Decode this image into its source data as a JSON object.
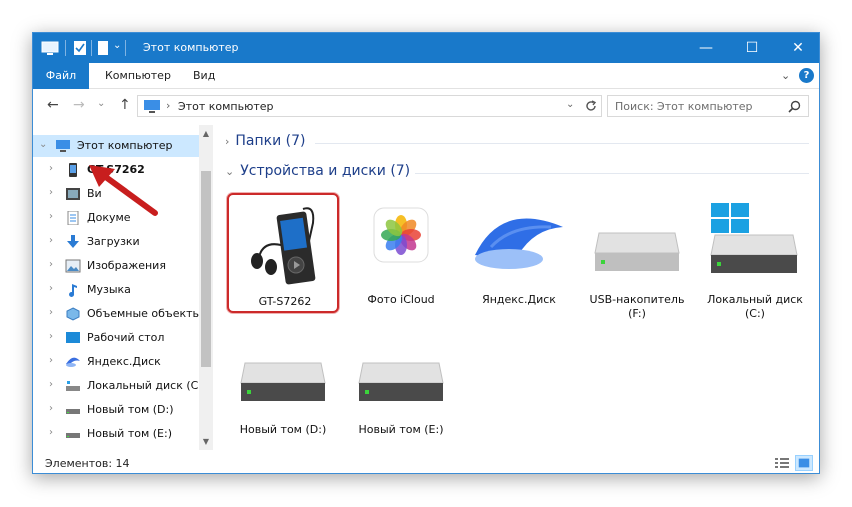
{
  "window": {
    "title": "Этот компьютер",
    "controls": {
      "minimize": "—",
      "maximize": "☐",
      "close": "✕"
    }
  },
  "ribbon": {
    "tabs": [
      {
        "label": "Файл",
        "active": true
      },
      {
        "label": "Компьютер"
      },
      {
        "label": "Вид"
      }
    ],
    "help": "?",
    "expand": "⌄"
  },
  "nav": {
    "back": "←",
    "forward": "→",
    "recent": "⌄",
    "up": "↑",
    "address": "Этот компьютер",
    "address_separator": "›",
    "search_placeholder": "Поиск: Этот компьютер"
  },
  "tree": {
    "items": [
      {
        "label": "Этот компьютер",
        "icon": "pc-icon",
        "root": true,
        "selected": true,
        "chev": "⌄"
      },
      {
        "label": "GT-S7262",
        "icon": "phone-icon",
        "bold": true,
        "chev": "›"
      },
      {
        "label": "Ви",
        "icon": "video-icon",
        "chev": "›"
      },
      {
        "label": "Докуме",
        "icon": "document-icon",
        "chev": "›"
      },
      {
        "label": "Загрузки",
        "icon": "download-icon",
        "chev": "›"
      },
      {
        "label": "Изображения",
        "icon": "pictures-icon",
        "chev": "›"
      },
      {
        "label": "Музыка",
        "icon": "music-icon",
        "chev": "›"
      },
      {
        "label": "Объемные объекты",
        "icon": "3d-objects-icon",
        "chev": "›"
      },
      {
        "label": "Рабочий стол",
        "icon": "desktop-icon",
        "chev": "›"
      },
      {
        "label": "Яндекс.Диск",
        "icon": "yandex-disk-icon",
        "chev": "›"
      },
      {
        "label": "Локальный диск (C:",
        "icon": "system-drive-icon",
        "chev": "›"
      },
      {
        "label": "Новый том (D:)",
        "icon": "drive-icon",
        "chev": "›"
      },
      {
        "label": "Новый том (E:)",
        "icon": "drive-icon",
        "chev": "›"
      }
    ]
  },
  "groups": {
    "folders": {
      "label": "Папки (7)",
      "chev": "›"
    },
    "devices": {
      "label": "Устройства и диски (7)",
      "chev": "⌄"
    }
  },
  "devices": [
    {
      "label": "GT-S7262",
      "icon": "media-player-icon",
      "selected": true
    },
    {
      "label": "Фото iCloud",
      "icon": "icloud-photos-icon"
    },
    {
      "label": "Яндекс.Диск",
      "icon": "yandex-disk-icon"
    },
    {
      "label": "USB-накопитель (F:)",
      "icon": "usb-drive-icon"
    },
    {
      "label": "Локальный диск (C:)",
      "icon": "windows-drive-icon"
    },
    {
      "label": "Новый том (D:)",
      "icon": "drive-icon"
    },
    {
      "label": "Новый том (E:)",
      "icon": "drive-icon"
    }
  ],
  "status": {
    "text": "Элементов: 14"
  },
  "colors": {
    "accent": "#1979ca",
    "selection": "#cce8ff",
    "highlight": "#cc2a2a",
    "group_text": "#1e3f8a"
  }
}
